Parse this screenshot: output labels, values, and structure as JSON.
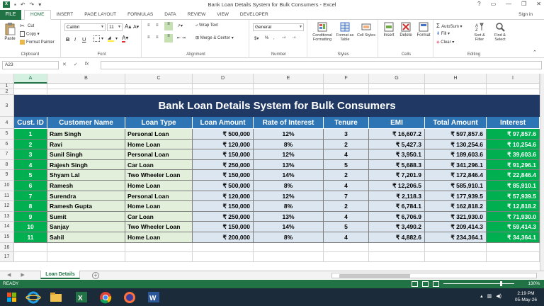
{
  "window": {
    "title": "Bank Loan Details System for Bulk Consumers - Excel",
    "controls": [
      "?",
      "▭",
      "—",
      "❐",
      "✕"
    ]
  },
  "ribbon_tabs": [
    "FILE",
    "HOME",
    "INSERT",
    "PAGE LAYOUT",
    "FORMULAS",
    "DATA",
    "REVIEW",
    "VIEW",
    "DEVELOPER"
  ],
  "active_tab": "HOME",
  "sign_in": "Sign in",
  "ribbon": {
    "clipboard": {
      "label": "Clipboard",
      "paste": "Paste",
      "cut": "Cut",
      "copy": "Copy",
      "format_painter": "Format Painter"
    },
    "font": {
      "label": "Font",
      "name": "Calibri",
      "size": "11",
      "bold": "B",
      "italic": "I",
      "underline": "U",
      "grow": "A",
      "shrink": "A"
    },
    "alignment": {
      "label": "Alignment",
      "wrap": "Wrap Text",
      "merge": "Merge & Center"
    },
    "number": {
      "label": "Number",
      "format": "General",
      "percent": "%",
      "comma": ",",
      "currency": "$"
    },
    "styles": {
      "label": "Styles",
      "conditional": "Conditional Formatting",
      "format_table": "Format as Table",
      "cell_styles": "Cell Styles"
    },
    "cells": {
      "label": "Cells",
      "insert": "Insert",
      "delete": "Delete",
      "format": "Format"
    },
    "editing": {
      "label": "Editing",
      "autosum": "AutoSum",
      "fill": "Fill",
      "clear": "Clear",
      "sort": "Sort & Filter",
      "find": "Find & Select"
    }
  },
  "formula_bar": {
    "name_box": "A23",
    "fx": "fx",
    "value": ""
  },
  "columns": [
    "A",
    "B",
    "C",
    "D",
    "E",
    "F",
    "G",
    "H",
    "I"
  ],
  "selected_column": "A",
  "row_numbers": [
    "1",
    "2",
    "3",
    "4",
    "5",
    "6",
    "7",
    "8",
    "9",
    "10",
    "11",
    "12",
    "13",
    "14",
    "15",
    "16",
    "17"
  ],
  "sheet_title": "Bank Loan Details System for Bulk Consumers",
  "table": {
    "headers": [
      "Cust. ID",
      "Customer Name",
      "Loan Type",
      "Loan Amount",
      "Rate of Interest",
      "Tenure",
      "EMI",
      "Total Amount",
      "Interest"
    ],
    "rows": [
      [
        "1",
        "Ram Singh",
        "Personal Loan",
        "₹ 500,000",
        "12%",
        "3",
        "₹ 16,607.2",
        "₹ 597,857.6",
        "₹ 97,857.6"
      ],
      [
        "2",
        "Ravi",
        "Home Loan",
        "₹ 120,000",
        "8%",
        "2",
        "₹ 5,427.3",
        "₹ 130,254.6",
        "₹ 10,254.6"
      ],
      [
        "3",
        "Sunil Singh",
        "Personal Loan",
        "₹ 150,000",
        "12%",
        "4",
        "₹ 3,950.1",
        "₹ 189,603.6",
        "₹ 39,603.6"
      ],
      [
        "4",
        "Rajesh Singh",
        "Car Loan",
        "₹ 250,000",
        "13%",
        "5",
        "₹ 5,688.3",
        "₹ 341,296.1",
        "₹ 91,296.1"
      ],
      [
        "5",
        "Shyam Lal",
        "Two Wheeler Loan",
        "₹ 150,000",
        "14%",
        "2",
        "₹ 7,201.9",
        "₹ 172,846.4",
        "₹ 22,846.4"
      ],
      [
        "6",
        "Ramesh",
        "Home Loan",
        "₹ 500,000",
        "8%",
        "4",
        "₹ 12,206.5",
        "₹ 585,910.1",
        "₹ 85,910.1"
      ],
      [
        "7",
        "Surendra",
        "Personal Loan",
        "₹ 120,000",
        "12%",
        "7",
        "₹ 2,118.3",
        "₹ 177,939.5",
        "₹ 57,939.5"
      ],
      [
        "8",
        "Ramesh Gupta",
        "Home Loan",
        "₹ 150,000",
        "8%",
        "2",
        "₹ 6,784.1",
        "₹ 162,818.2",
        "₹ 12,818.2"
      ],
      [
        "9",
        "Sumit",
        "Car Loan",
        "₹ 250,000",
        "13%",
        "4",
        "₹ 6,706.9",
        "₹ 321,930.0",
        "₹ 71,930.0"
      ],
      [
        "10",
        "Sanjay",
        "Two Wheeler Loan",
        "₹ 150,000",
        "14%",
        "5",
        "₹ 3,490.2",
        "₹ 209,414.3",
        "₹ 59,414.3"
      ],
      [
        "11",
        "Sahil",
        "Home Loan",
        "₹ 200,000",
        "8%",
        "4",
        "₹ 4,882.6",
        "₹ 234,364.1",
        "₹ 34,364.1"
      ]
    ]
  },
  "sheet_tabs": [
    "Loan Details"
  ],
  "active_sheet": "Loan Details",
  "status": {
    "ready": "READY",
    "zoom": "130%"
  },
  "taskbar": {
    "time": "2:19 PM",
    "date": "05-May-26"
  },
  "colors": {
    "excel_green": "#217346",
    "title_navy": "#1f3864",
    "header_blue": "#2e75b6",
    "id_green": "#00b050",
    "name_bg": "#e2efda",
    "value_bg": "#dce6f1"
  }
}
